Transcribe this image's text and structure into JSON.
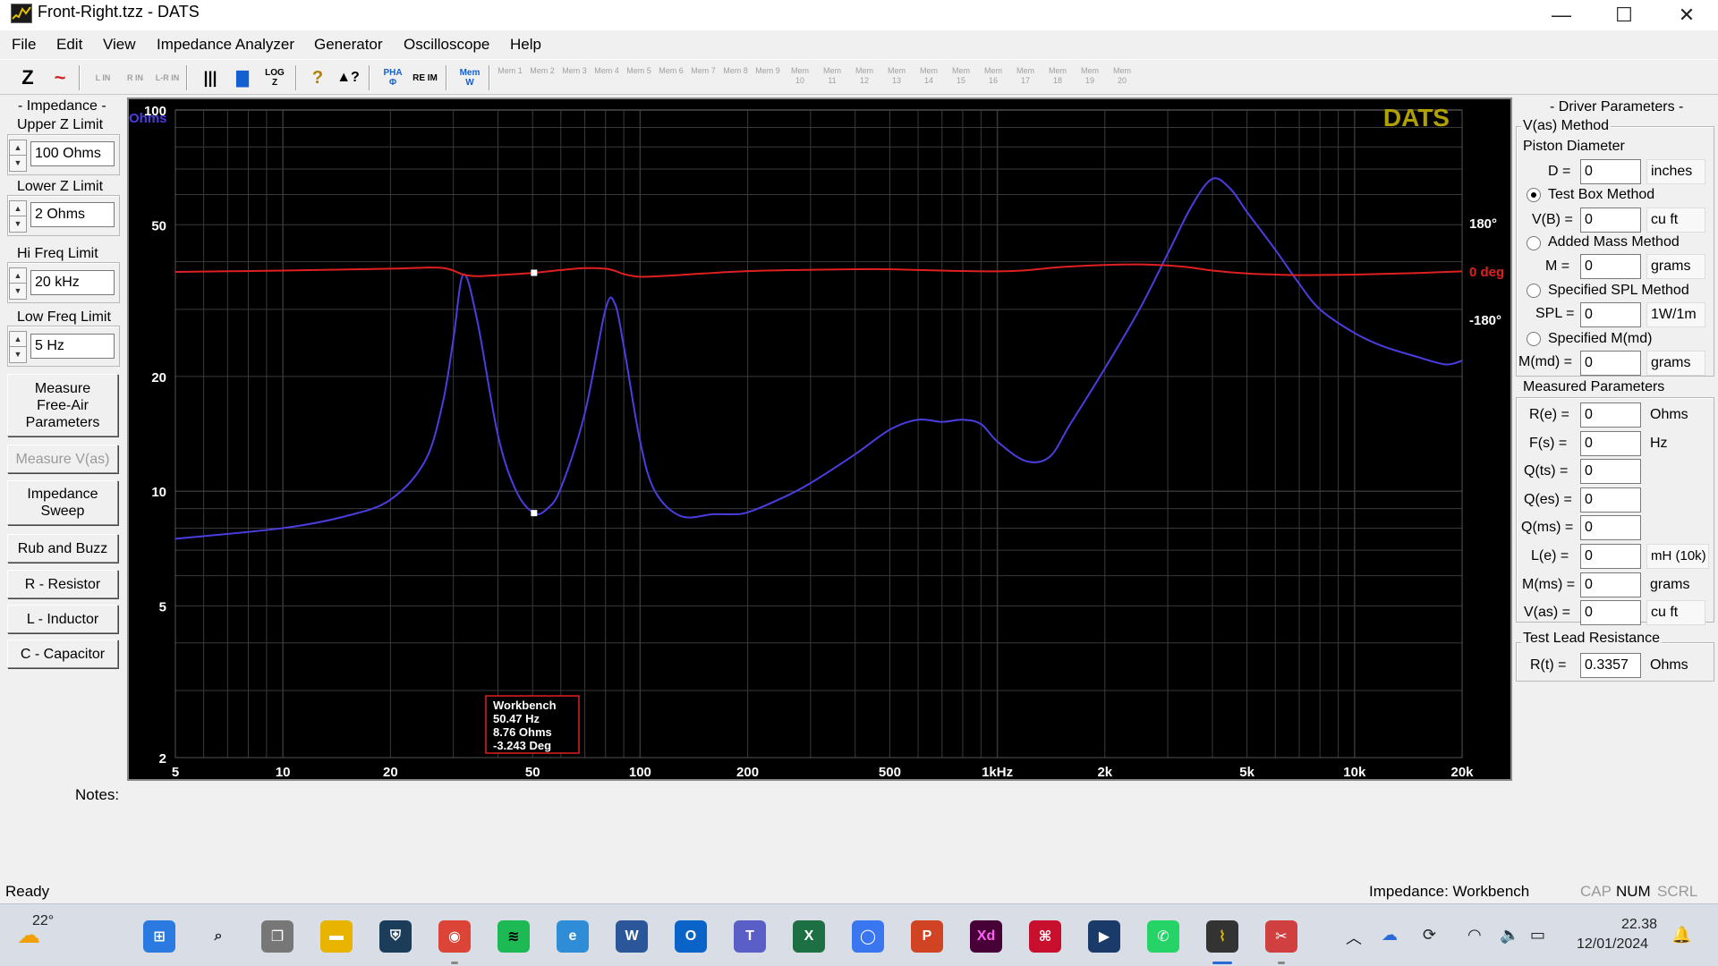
{
  "window": {
    "title": "Front-Right.tzz - DATS",
    "minimize": "—",
    "maximize": "☐",
    "close": "✕"
  },
  "menu": [
    "File",
    "Edit",
    "View",
    "Impedance Analyzer",
    "Generator",
    "Oscilloscope",
    "Help"
  ],
  "toolbar": {
    "buttons": [
      "Z",
      "~",
      "L IN",
      "R IN",
      "L-R IN",
      "|||",
      "▇",
      "LOG Z",
      "?",
      "▲?",
      "PHA Φ",
      "RE IM",
      "Mem W"
    ],
    "mem_slots": [
      "1",
      "2",
      "3",
      "4",
      "5",
      "6",
      "7",
      "8",
      "9",
      "10",
      "11",
      "12",
      "13",
      "14",
      "15",
      "16",
      "17",
      "18",
      "19",
      "20"
    ],
    "mem_label": "Mem"
  },
  "left_panel": {
    "title": "- Impedance -",
    "upper_z_label": "Upper Z Limit",
    "upper_z_value": "100 Ohms",
    "lower_z_label": "Lower Z Limit",
    "lower_z_value": "2 Ohms",
    "hi_freq_label": "Hi Freq Limit",
    "hi_freq_value": "20 kHz",
    "low_freq_label": "Low Freq Limit",
    "low_freq_value": "5 Hz",
    "btn_measure_free_air": "Measure Free-Air Parameters",
    "btn_measure_vas": "Measure V(as)",
    "btn_impedance_sweep": "Impedance Sweep",
    "btn_rub_buzz": "Rub and Buzz",
    "btn_resistor": "R - Resistor",
    "btn_inductor": "L - Inductor",
    "btn_capacitor": "C - Capacitor"
  },
  "graph": {
    "logo": "DATS",
    "y_unit": "Ohms",
    "y_ticks": [
      "100",
      "50",
      "20",
      "10",
      "5",
      "2"
    ],
    "phase_ticks": [
      "180°",
      "0 deg",
      "-180°"
    ],
    "x_ticks": [
      "5",
      "10",
      "20",
      "50",
      "100",
      "200",
      "500",
      "1kHz",
      "2k",
      "5k",
      "10k",
      "20k"
    ],
    "cursor_box": [
      "Workbench",
      "50.47 Hz",
      "8.76 Ohms",
      "-3.243 Deg"
    ],
    "colors": {
      "impedance": "#4b3ee0",
      "phase": "#e02020",
      "grid": "#3a3a3a",
      "logo": "#b0a000",
      "text": "#ffffff"
    }
  },
  "chart_data": {
    "type": "line",
    "title": "",
    "xlabel": "",
    "ylabel": "Ohms",
    "x_scale": "log",
    "y_scale": "log",
    "xlim": [
      5,
      20000
    ],
    "ylim": [
      2,
      100
    ],
    "y2lim": [
      -180,
      180
    ],
    "series": [
      {
        "name": "",
        "axis": "impedance",
        "x": [
          5,
          10,
          15,
          20,
          25,
          28,
          30,
          32,
          35,
          40,
          45,
          50.47,
          55,
          60,
          70,
          80,
          85,
          90,
          100,
          110,
          130,
          160,
          180,
          200,
          250,
          300,
          400,
          500,
          600,
          700,
          800,
          900,
          1000,
          1200,
          1400,
          1600,
          2000,
          2500,
          3000,
          3500,
          4000,
          4500,
          5000,
          6000,
          7000,
          8000,
          10000,
          12000,
          15000,
          18000,
          20000
        ],
        "y": [
          7.5,
          8.0,
          8.6,
          9.5,
          12.0,
          17.0,
          25.0,
          37.0,
          28.0,
          14.0,
          10.0,
          8.76,
          9.0,
          10.2,
          16.0,
          30.0,
          31.0,
          24.0,
          13.5,
          10.0,
          8.6,
          8.7,
          8.7,
          8.8,
          9.6,
          10.5,
          12.5,
          14.5,
          15.4,
          15.2,
          15.4,
          15.0,
          13.5,
          12.0,
          12.3,
          15.0,
          21.0,
          30.0,
          42.0,
          56.0,
          66.0,
          62.0,
          54.0,
          43.0,
          35.0,
          30.0,
          26.0,
          24.0,
          22.5,
          21.5,
          22.0
        ]
      },
      {
        "name": "",
        "axis": "phase",
        "x": [
          5,
          10,
          20,
          25,
          28,
          30,
          32,
          35,
          40,
          50.47,
          60,
          70,
          80,
          85,
          90,
          100,
          120,
          150,
          200,
          300,
          400,
          500,
          700,
          1000,
          1200,
          1500,
          2000,
          2500,
          3000,
          3500,
          4000,
          5000,
          6000,
          7000,
          10000,
          15000,
          20000
        ],
        "y": [
          0,
          5,
          12,
          16,
          15,
          5,
          -10,
          -16,
          -12,
          -3.2,
          7,
          14,
          12,
          4,
          -8,
          -18,
          -14,
          -6,
          3,
          8,
          10,
          10,
          5,
          2,
          6,
          18,
          26,
          28,
          24,
          16,
          5,
          -6,
          -10,
          -12,
          -10,
          -4,
          2
        ]
      }
    ],
    "cursor": {
      "x": 50.47,
      "impedance": 8.76,
      "phase": -3.243
    },
    "grid": true
  },
  "right_panel": {
    "title": "- Driver Parameters -",
    "vas_method_label": "V(as) Method",
    "piston_label": "Piston Diameter",
    "d_label": "D =",
    "d_value": "0",
    "d_unit": "inches",
    "test_box_label": "Test Box Method",
    "vb_label": "V(B) =",
    "vb_value": "0",
    "vb_unit": "cu ft",
    "added_mass_label": "Added Mass Method",
    "m_label": "M =",
    "m_value": "0",
    "m_unit": "grams",
    "spl_method_label": "Specified SPL Method",
    "spl_label": "SPL =",
    "spl_value": "0",
    "spl_unit": "1W/1m",
    "mmd_method_label": "Specified M(md)",
    "mmd_label": "M(md) =",
    "mmd_value": "0",
    "mmd_unit": "grams",
    "measured_title": "Measured Parameters",
    "re_label": "R(e) =",
    "re_value": "0",
    "re_unit": "Ohms",
    "fs_label": "F(s) =",
    "fs_value": "0",
    "fs_unit": "Hz",
    "qts_label": "Q(ts) =",
    "qts_value": "0",
    "qes_label": "Q(es) =",
    "qes_value": "0",
    "qms_label": "Q(ms) =",
    "qms_value": "0",
    "le_label": "L(e) =",
    "le_value": "0",
    "le_unit": "mH (10k)",
    "mms_label": "M(ms) =",
    "mms_value": "0",
    "mms_unit": "grams",
    "vas_label": "V(as) =",
    "vas_value": "0",
    "vas_unit": "cu ft",
    "lead_title": "Test Lead Resistance",
    "rt_label": "R(t) =",
    "rt_value": "0.3357",
    "rt_unit": "Ohms"
  },
  "notes_label": "Notes:",
  "status": {
    "left": "Ready",
    "mode": "Impedance: Workbench",
    "cap": "CAP",
    "num": "NUM",
    "scrl": "SCRL"
  },
  "taskbar": {
    "weather": "22°",
    "time": "22.38",
    "date": "12/01/2024",
    "apps": [
      "start",
      "search",
      "task-view",
      "file-explorer",
      "bitwarden",
      "chrome",
      "spotify",
      "edge",
      "word",
      "outlook",
      "teams",
      "excel",
      "signal",
      "powerpoint",
      "adobe-xd",
      "acrobat",
      "media-player",
      "whatsapp",
      "dats",
      "snipping-tool"
    ]
  }
}
